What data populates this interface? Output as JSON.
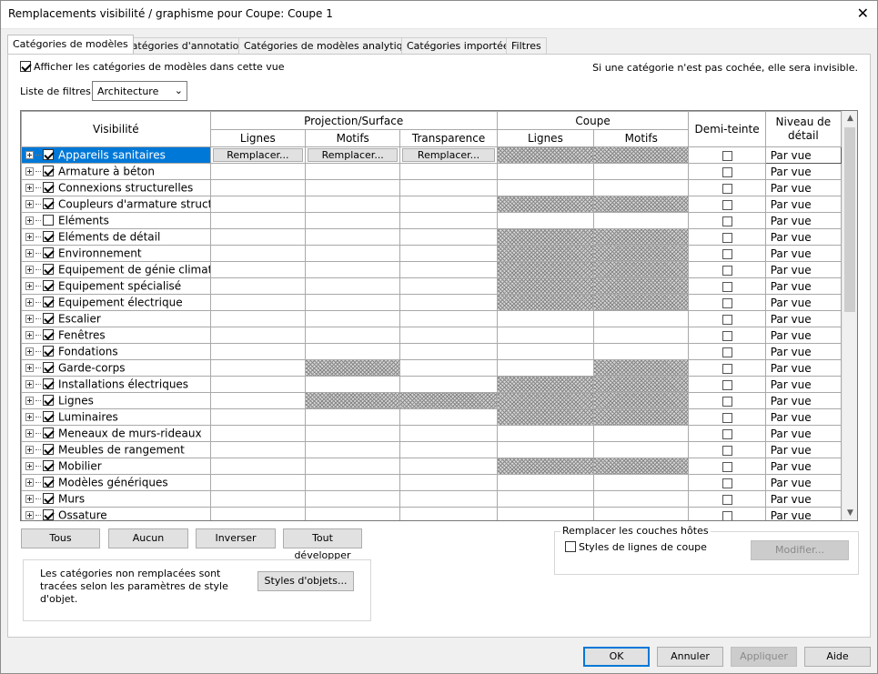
{
  "window": {
    "title": "Remplacements visibilité / graphisme pour Coupe: Coupe 1",
    "close_glyph": "✕"
  },
  "tabs": [
    {
      "label": "Catégories de modèles",
      "active": true
    },
    {
      "label": "Catégories d'annotations",
      "active": false
    },
    {
      "label": "Catégories de modèles analytiques",
      "active": false
    },
    {
      "label": "Catégories importées",
      "active": false
    },
    {
      "label": "Filtres",
      "active": false
    }
  ],
  "panel": {
    "show_checkbox_label": "Afficher les catégories de modèles dans cette vue",
    "show_checked": true,
    "hint": "Si une catégorie n'est pas cochée, elle sera invisible.",
    "filter_label": "Liste de filtres:",
    "filter_value": "Architecture"
  },
  "table": {
    "headers": {
      "visibility": "Visibilité",
      "projection": "Projection/Surface",
      "cut": "Coupe",
      "halftone": "Demi-teinte",
      "detail_level": "Niveau de détail",
      "proj_lines": "Lignes",
      "proj_patterns": "Motifs",
      "proj_transparency": "Transparence",
      "cut_lines": "Lignes",
      "cut_patterns": "Motifs"
    },
    "override_label": "Remplacer...",
    "rows": [
      {
        "name": "Appareils sanitaires",
        "checked": true,
        "detail": "Par vue"
      },
      {
        "name": "Armature à béton",
        "checked": true,
        "detail": "Par vue"
      },
      {
        "name": "Connexions structurelles",
        "checked": true,
        "detail": "Par vue"
      },
      {
        "name": "Coupleurs d'armature struct...",
        "checked": true,
        "detail": "Par vue"
      },
      {
        "name": "Eléments",
        "checked": false,
        "detail": "Par vue"
      },
      {
        "name": "Eléments de détail",
        "checked": true,
        "detail": "Par vue"
      },
      {
        "name": "Environnement",
        "checked": true,
        "detail": "Par vue"
      },
      {
        "name": "Equipement de génie climat...",
        "checked": true,
        "detail": "Par vue"
      },
      {
        "name": "Equipement spécialisé",
        "checked": true,
        "detail": "Par vue"
      },
      {
        "name": "Equipement électrique",
        "checked": true,
        "detail": "Par vue"
      },
      {
        "name": "Escalier",
        "checked": true,
        "detail": "Par vue"
      },
      {
        "name": "Fenêtres",
        "checked": true,
        "detail": "Par vue"
      },
      {
        "name": "Fondations",
        "checked": true,
        "detail": "Par vue"
      },
      {
        "name": "Garde-corps",
        "checked": true,
        "detail": "Par vue"
      },
      {
        "name": "Installations électriques",
        "checked": true,
        "detail": "Par vue"
      },
      {
        "name": "Lignes",
        "checked": true,
        "detail": "Par vue"
      },
      {
        "name": "Luminaires",
        "checked": true,
        "detail": "Par vue"
      },
      {
        "name": "Meneaux de murs-rideaux",
        "checked": true,
        "detail": "Par vue"
      },
      {
        "name": "Meubles de rangement",
        "checked": true,
        "detail": "Par vue"
      },
      {
        "name": "Mobilier",
        "checked": true,
        "detail": "Par vue"
      },
      {
        "name": "Modèles génériques",
        "checked": true,
        "detail": "Par vue"
      },
      {
        "name": "Murs",
        "checked": true,
        "detail": "Par vue"
      },
      {
        "name": "Ossature",
        "checked": true,
        "detail": "Par vue"
      }
    ]
  },
  "actions": {
    "all": "Tous",
    "none": "Aucun",
    "invert": "Inverser",
    "expand_all": "Tout développer"
  },
  "host_layers": {
    "legend": "Remplacer les couches hôtes",
    "cut_line_styles": "Styles de lignes de coupe",
    "cut_line_styles_checked": false,
    "edit": "Modifier..."
  },
  "info": {
    "text": "Les catégories non remplacées sont tracées selon les paramètres de style d'objet.",
    "object_styles": "Styles d'objets..."
  },
  "footer": {
    "ok": "OK",
    "cancel": "Annuler",
    "apply": "Appliquer",
    "help": "Aide"
  },
  "colors": {
    "selection": "#0078d7",
    "primary_border": "#0078d7"
  }
}
